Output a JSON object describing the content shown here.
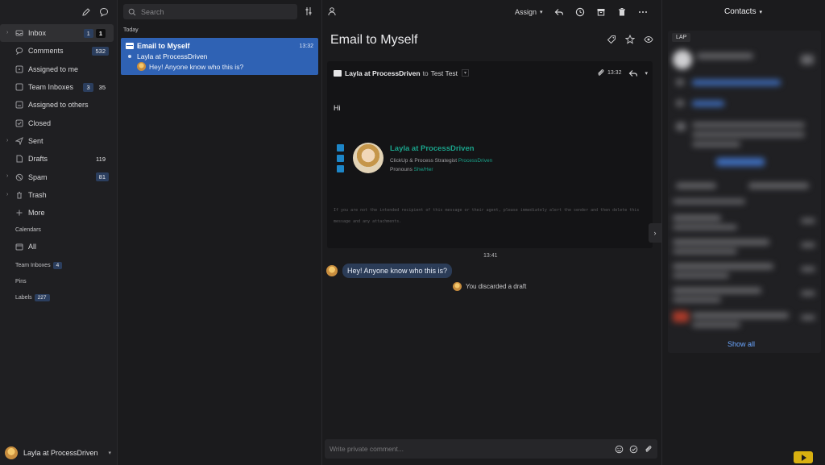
{
  "sidebar": {
    "items": [
      {
        "label": "Inbox",
        "count1": "1",
        "count2": "1"
      },
      {
        "label": "Comments",
        "count": "532"
      },
      {
        "label": "Assigned to me"
      },
      {
        "label": "Team Inboxes",
        "count1": "3",
        "count2": "35"
      },
      {
        "label": "Assigned to others"
      },
      {
        "label": "Closed"
      },
      {
        "label": "Sent"
      },
      {
        "label": "Drafts",
        "count": "119"
      },
      {
        "label": "Spam",
        "count": "81"
      },
      {
        "label": "Trash"
      },
      {
        "label": "More"
      }
    ],
    "calendars_label": "Calendars",
    "calendars_all": "All",
    "team_inboxes_label": "Team Inboxes",
    "team_inboxes_count": "4",
    "pins_label": "Pins",
    "labels_label": "Labels",
    "labels_count": "227",
    "user_name": "Layla at ProcessDriven"
  },
  "list": {
    "search_placeholder": "Search",
    "day_label": "Today",
    "conversation": {
      "subject": "Email to Myself",
      "time": "13:32",
      "from": "Layla at ProcessDriven",
      "preview": "Hey! Anyone know who this is?"
    }
  },
  "toolbar": {
    "assign_label": "Assign"
  },
  "message": {
    "subject": "Email to Myself",
    "from": "Layla at ProcessDriven",
    "to_word": "to",
    "to": "Test Test",
    "time": "13:32",
    "greeting": "Hi",
    "signature": {
      "name": "Layla at ProcessDriven",
      "role": "ClickUp & Process Strategist",
      "company": "ProcessDriven",
      "pronouns_label": "Pronouns",
      "pronouns": "She/Her"
    },
    "disclaimer": "If you are not the intended recipient of this message or their agent, please immediately alert the sender and then delete this message and any attachments."
  },
  "thread": {
    "timestamp": "13:41",
    "comment": "Hey! Anyone know who this is?",
    "discard_note": "You discarded a draft",
    "comment_placeholder": "Write private comment..."
  },
  "contacts": {
    "title": "Contacts",
    "badge": "LAP",
    "show_all": "Show all"
  },
  "colors": {
    "accent_blue": "#2f62b4",
    "signature_green": "#1aa28a",
    "link_blue": "#6aa6ff"
  }
}
